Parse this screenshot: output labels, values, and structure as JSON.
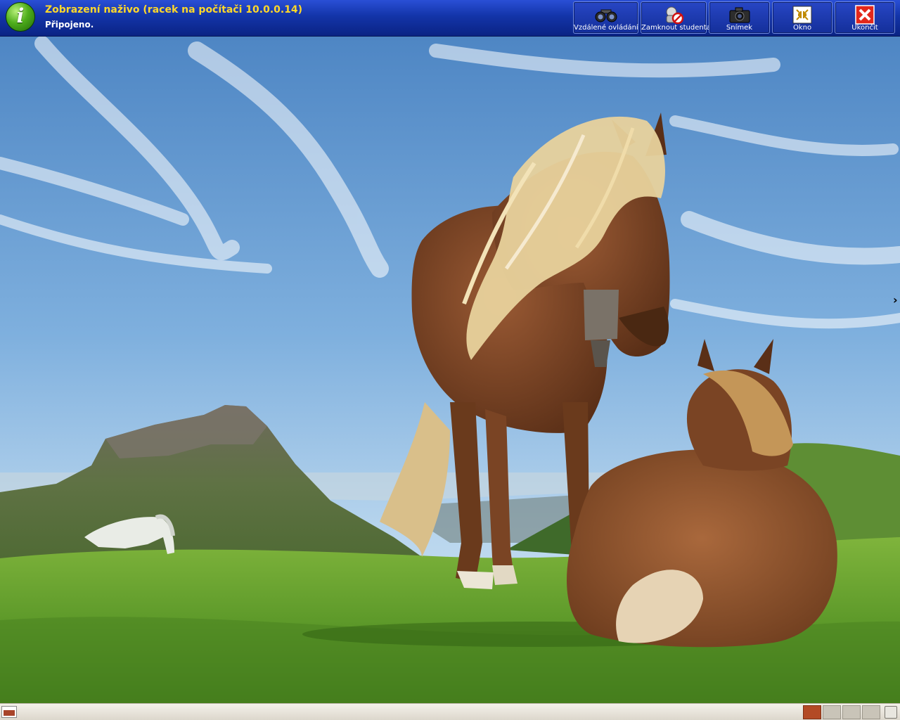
{
  "window": {
    "title": "Zobrazení naživo (racek na počítači 10.0.0.14)",
    "status": "Připojeno."
  },
  "toolbar": {
    "buttons": [
      {
        "label": "Vzdálené ovládání",
        "icon": "binoculars-icon"
      },
      {
        "label": "Zamknout studenta",
        "icon": "lock-student-icon"
      },
      {
        "label": "Snímek",
        "icon": "camera-icon"
      },
      {
        "label": "Okno",
        "icon": "window-restore-icon"
      },
      {
        "label": "Ukončit",
        "icon": "close-icon"
      }
    ]
  },
  "taskbar": {
    "workspaces": 4,
    "active_workspace": 1,
    "accent_color": "#b34a25"
  },
  "colors": {
    "toolbar_blue": "#1334a8",
    "title_yellow": "#ffd82a"
  }
}
